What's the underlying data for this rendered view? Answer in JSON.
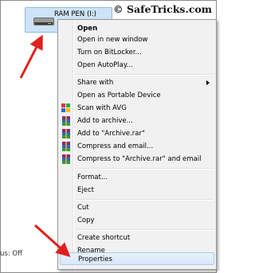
{
  "watermark": "© SafeTricks.com",
  "drive": {
    "label": "RAM PEN (I:)",
    "icon": "usb-drive-icon"
  },
  "status_text": "us: Off",
  "menu": {
    "open": "Open",
    "open_new_window": "Open in new window",
    "bitlocker": "Turn on BitLocker...",
    "autoplay": "Open AutoPlay...",
    "share_with": "Share with",
    "portable": "Open as Portable Device",
    "scan_avg": "Scan with AVG",
    "add_archive": "Add to archive...",
    "add_rar": "Add to \"Archive.rar\"",
    "compress_email": "Compress and email...",
    "compress_rar_email": "Compress to \"Archive.rar\" and email",
    "format": "Format...",
    "eject": "Eject",
    "cut": "Cut",
    "copy": "Copy",
    "shortcut": "Create shortcut",
    "rename": "Rename",
    "properties": "Properties"
  },
  "colors": {
    "arrow": "#e0201f",
    "highlight": "#d7e7f9",
    "selection": "#cfe3f7"
  }
}
